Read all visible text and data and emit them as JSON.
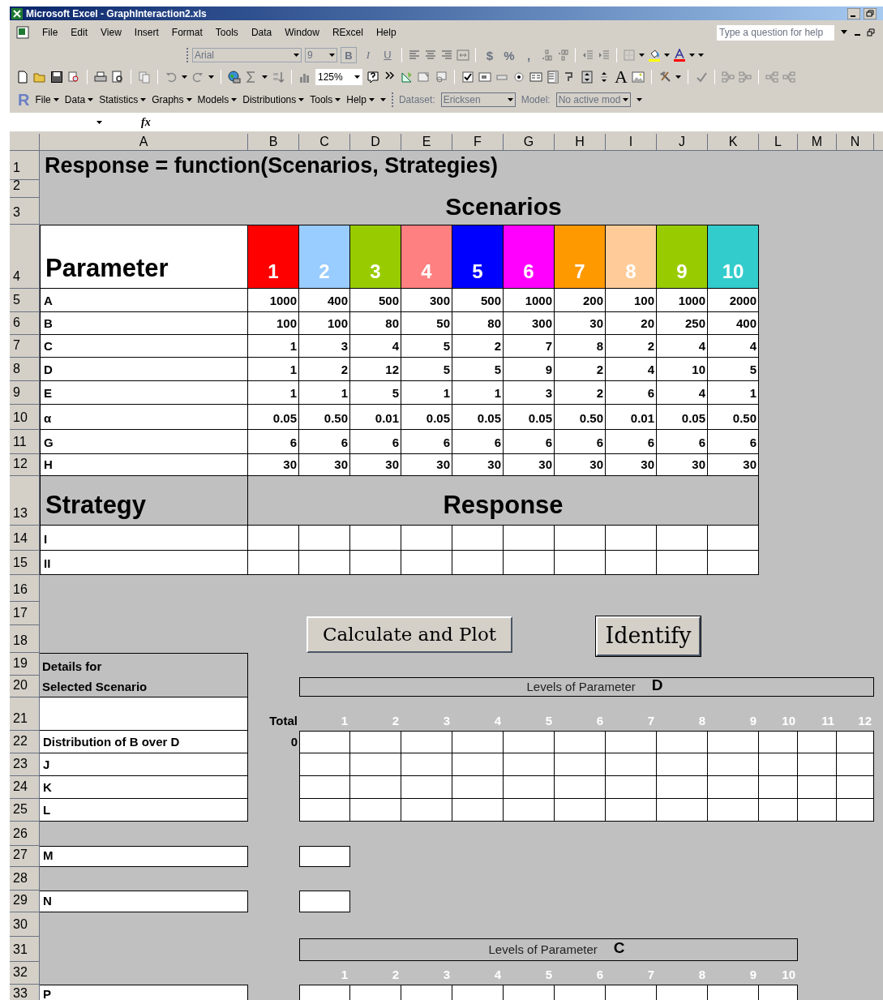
{
  "window": {
    "title": "Microsoft Excel - GraphInteraction2.xls"
  },
  "menu": [
    "File",
    "Edit",
    "View",
    "Insert",
    "Format",
    "Tools",
    "Data",
    "Window",
    "RExcel",
    "Help"
  ],
  "help_box": {
    "placeholder": "Type a question for help"
  },
  "formatting_toolbar": {
    "font": "Arial",
    "size": "9",
    "style_buttons": [
      "B",
      "I",
      "U"
    ],
    "number_buttons": [
      "$",
      "%",
      ","
    ]
  },
  "standard_toolbar": {
    "zoom": "125%",
    "label_tool": "A"
  },
  "rexcel_toolbar": {
    "logo": "R",
    "menus": [
      "File",
      "Data",
      "Statistics",
      "Graphs",
      "Models",
      "Distributions",
      "Tools",
      "Help"
    ],
    "dataset_label": "Dataset:",
    "dataset": "Ericksen",
    "model_label": "Model:",
    "model": "No active mod"
  },
  "formula_bar": {
    "fx": "fx"
  },
  "columns": [
    "A",
    "B",
    "C",
    "D",
    "E",
    "F",
    "G",
    "H",
    "I",
    "J",
    "K",
    "L",
    "M",
    "N"
  ],
  "rows": [
    "1",
    "2",
    "3",
    "4",
    "5",
    "6",
    "7",
    "8",
    "9",
    "10",
    "11",
    "12",
    "13",
    "14",
    "15",
    "16",
    "17",
    "18",
    "19",
    "20",
    "21",
    "22",
    "23",
    "24",
    "25",
    "26",
    "27",
    "28",
    "29",
    "30",
    "31",
    "32",
    "33"
  ],
  "sheet": {
    "title": "Response = function(Scenarios, Strategies)",
    "scenarios_heading": "Scenarios",
    "parameter_heading": "Parameter",
    "scenarios": [
      {
        "label": "1",
        "color": "#ff0000"
      },
      {
        "label": "2",
        "color": "#99ccff"
      },
      {
        "label": "3",
        "color": "#99cc00"
      },
      {
        "label": "4",
        "color": "#ff8080"
      },
      {
        "label": "5",
        "color": "#0000ff"
      },
      {
        "label": "6",
        "color": "#ff00ff"
      },
      {
        "label": "7",
        "color": "#ff9900"
      },
      {
        "label": "8",
        "color": "#ffcc99"
      },
      {
        "label": "9",
        "color": "#99cc00"
      },
      {
        "label": "10",
        "color": "#33cccc"
      }
    ],
    "parameters": [
      {
        "name": "A",
        "values": [
          "1000",
          "400",
          "500",
          "300",
          "500",
          "1000",
          "200",
          "100",
          "1000",
          "2000"
        ]
      },
      {
        "name": "B",
        "values": [
          "100",
          "100",
          "80",
          "50",
          "80",
          "300",
          "30",
          "20",
          "250",
          "400"
        ]
      },
      {
        "name": "C",
        "values": [
          "1",
          "3",
          "4",
          "5",
          "2",
          "7",
          "8",
          "2",
          "4",
          "4"
        ]
      },
      {
        "name": "D",
        "values": [
          "1",
          "2",
          "12",
          "5",
          "5",
          "9",
          "2",
          "4",
          "10",
          "5"
        ]
      },
      {
        "name": "E",
        "values": [
          "1",
          "1",
          "5",
          "1",
          "1",
          "3",
          "2",
          "6",
          "4",
          "1"
        ]
      },
      {
        "name": "α",
        "values": [
          "0.05",
          "0.50",
          "0.01",
          "0.05",
          "0.05",
          "0.05",
          "0.50",
          "0.01",
          "0.05",
          "0.50"
        ]
      },
      {
        "name": "G",
        "values": [
          "6",
          "6",
          "6",
          "6",
          "6",
          "6",
          "6",
          "6",
          "6",
          "6"
        ]
      },
      {
        "name": "H",
        "values": [
          "30",
          "30",
          "30",
          "30",
          "30",
          "30",
          "30",
          "30",
          "30",
          "30"
        ]
      }
    ],
    "strategy_heading": "Strategy",
    "response_heading": "Response",
    "strategies": [
      "I",
      "II"
    ],
    "buttons": [
      "Calculate and Plot",
      "Identify"
    ],
    "details": [
      "Details for",
      "Selected Scenario"
    ],
    "total_label": "Total",
    "total_value": "0",
    "detail_rows": [
      "Distribution of B over D",
      "J",
      "K",
      "L"
    ],
    "levels_d": {
      "label": "Levels of Parameter",
      "parameter": "D",
      "levels": [
        "1",
        "2",
        "3",
        "4",
        "5",
        "6",
        "7",
        "8",
        "9",
        "10",
        "11",
        "12"
      ]
    },
    "m_label": "M",
    "n_label": "N",
    "levels_c": {
      "label": "Levels of Parameter",
      "parameter": "C",
      "levels": [
        "1",
        "2",
        "3",
        "4",
        "5",
        "6",
        "7",
        "8",
        "9",
        "10"
      ]
    },
    "p_label": "P"
  }
}
